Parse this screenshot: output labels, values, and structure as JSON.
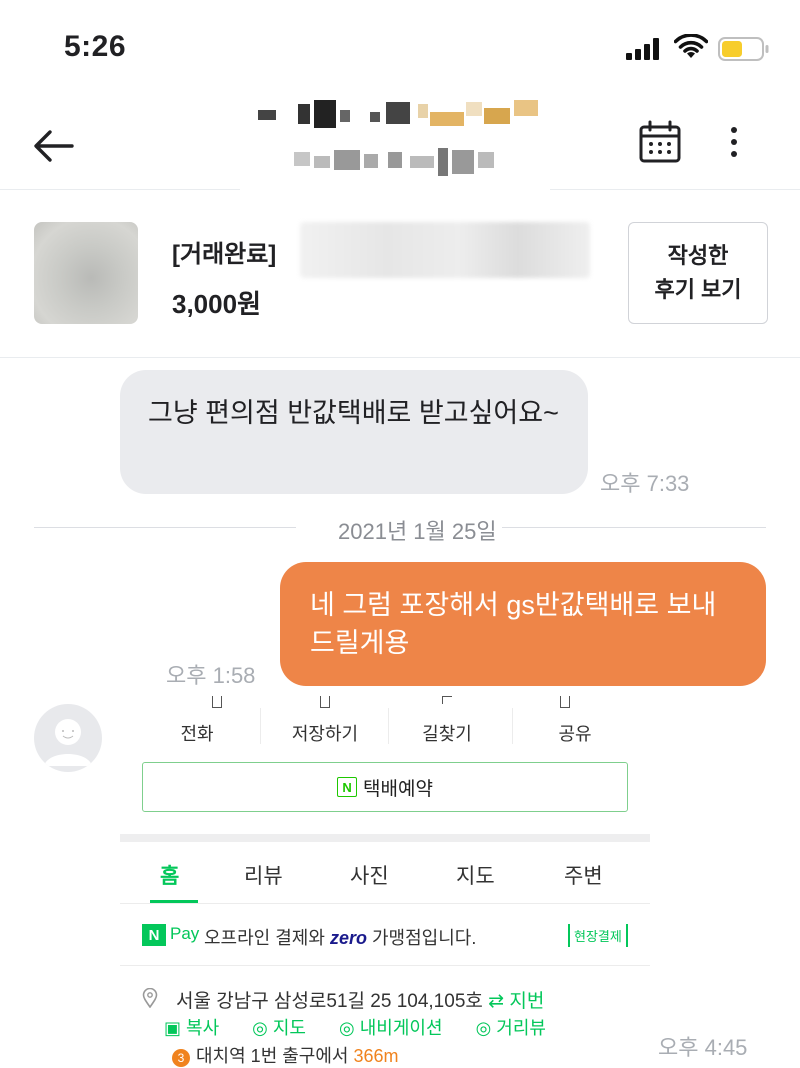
{
  "status_bar": {
    "time": "5:26",
    "icons": [
      "signal-icon",
      "wifi-icon",
      "battery-icon"
    ]
  },
  "header": {
    "back_icon": "arrow-left-icon",
    "calendar_icon": "calendar-icon",
    "more_icon": "more-vertical-icon"
  },
  "product": {
    "status": "[거래완료]",
    "price": "3,000원",
    "review_button": "작성한\n후기 보기"
  },
  "messages": [
    {
      "direction": "incoming",
      "text": "그냥 편의점 반값택배로 받고싶어요~",
      "time": "오후 7:33"
    },
    {
      "direction": "outgoing",
      "text": "네 그럼 포장해서 gs반값택배로 보내드릴게용",
      "time": "오후 1:58"
    },
    {
      "direction": "incoming",
      "type": "image",
      "time": "오후 4:45"
    }
  ],
  "date_separator": "2021년 1월 25일",
  "image_content": {
    "actions": [
      "전화",
      "저장하기",
      "길찾기",
      "공유"
    ],
    "booking_button": "택배예약",
    "booking_badge": "N",
    "tabs": [
      "홈",
      "리뷰",
      "사진",
      "지도",
      "주변"
    ],
    "active_tab": "홈",
    "pay": {
      "n_logo": "N",
      "pay_logo": "Pay",
      "text_before": "오프라인 결제와",
      "zero_logo": "zero",
      "text_after": "가맹점입니다.",
      "badge": "현장결제"
    },
    "address": "서울 강남구 삼성로51길 25 104,105호",
    "jibun_label": "⇄ 지번",
    "address_links": [
      "복사",
      "지도",
      "내비게이션",
      "거리뷰"
    ],
    "metro": {
      "line": "3",
      "text": "대치역 1번 출구에서",
      "distance": "366m"
    }
  },
  "colors": {
    "outgoing_bubble": "#ee8548",
    "incoming_bubble": "#eaebee",
    "naver_green": "#03c75a"
  }
}
